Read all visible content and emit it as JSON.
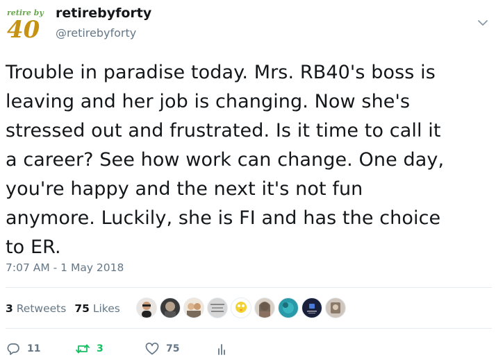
{
  "user": {
    "name": "retirebyforty",
    "handle": "@retirebyforty",
    "avatar_text_top": "retire by",
    "avatar_text_big": "40"
  },
  "tweet": {
    "lines": [
      "Trouble in paradise today. Mrs. RB40's boss is",
      "leaving and her job is changing. Now she's",
      "stressed out and frustrated. Is it time to call it",
      "a career? See how work can change. One day,",
      "you're happy and the next it's not fun",
      "anymore. Luckily, she is FI and has the choice",
      "to ER."
    ],
    "timestamp": "7:07 AM - 1 May 2018"
  },
  "stats": {
    "retweets_count": "3",
    "retweets_label": "Retweets",
    "likes_count": "75",
    "likes_label": "Likes"
  },
  "likers": [
    {
      "icon": "person-avatar",
      "color": "#c89a78"
    },
    {
      "icon": "person-avatar",
      "color": "#6b6b6b"
    },
    {
      "icon": "person-avatar",
      "color": "#d9b48e"
    },
    {
      "icon": "text-avatar",
      "color": "#c9c9c9"
    },
    {
      "icon": "bird-avatar",
      "color": "#f3d233"
    },
    {
      "icon": "person-avatar",
      "color": "#b9a08a"
    },
    {
      "icon": "teal-avatar",
      "color": "#2a9aa8"
    },
    {
      "icon": "dark-logo-avatar",
      "color": "#1a1f3a"
    },
    {
      "icon": "person-avatar",
      "color": "#8a7a6a"
    }
  ],
  "actions": {
    "reply_count": "11",
    "retweet_count": "3",
    "like_count": "75"
  },
  "colors": {
    "text": "#14171a",
    "muted": "#657786",
    "retweet_green": "#17bf63",
    "logo_green": "#6aa84f",
    "logo_gold": "#c69214"
  }
}
